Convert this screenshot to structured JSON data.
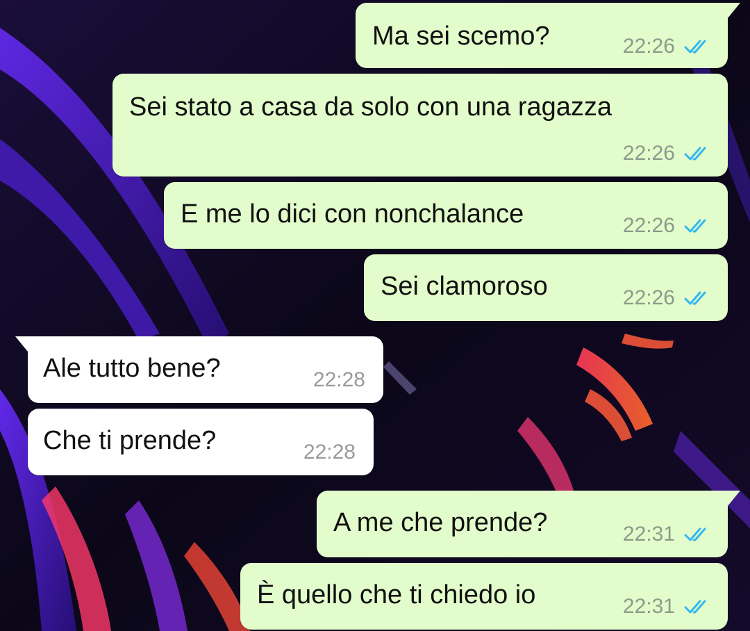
{
  "colors": {
    "outgoing_bubble": "#e2fdcb",
    "incoming_bubble": "#ffffff",
    "read_ticks": "#34b7f1",
    "timestamp": "#8a9a8a"
  },
  "icons": {
    "read_receipt": "double-check-icon"
  },
  "messages": [
    {
      "direction": "out",
      "text": "Ma sei scemo?",
      "time": "22:26",
      "status": "read"
    },
    {
      "direction": "out",
      "text": "Sei stato a casa da solo con una ragazza",
      "time": "22:26",
      "status": "read"
    },
    {
      "direction": "out",
      "text": "E me lo dici con nonchalance",
      "time": "22:26",
      "status": "read"
    },
    {
      "direction": "out",
      "text": "Sei clamoroso",
      "time": "22:26",
      "status": "read"
    },
    {
      "direction": "in",
      "text": "Ale tutto bene?",
      "time": "22:28"
    },
    {
      "direction": "in",
      "text": "Che ti prende?",
      "time": "22:28"
    },
    {
      "direction": "out",
      "text": "A me che prende?",
      "time": "22:31",
      "status": "read"
    },
    {
      "direction": "out",
      "text": "È quello che ti chiedo io",
      "time": "22:31",
      "status": "read"
    }
  ]
}
